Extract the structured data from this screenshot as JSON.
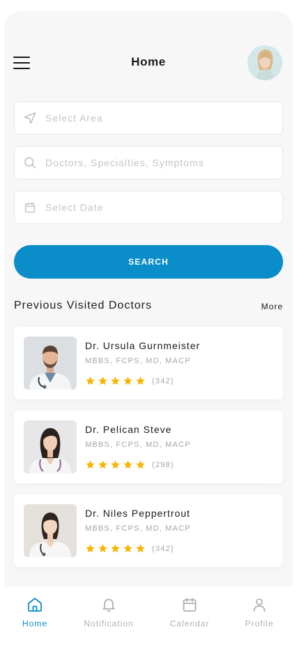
{
  "header": {
    "title": "Home",
    "menu_icon": "hamburger-menu-icon",
    "avatar_icon": "user-avatar"
  },
  "search": {
    "area_placeholder": "Select Area",
    "area_icon": "location-arrow-icon",
    "query_placeholder": "Doctors, Specialties, Symptoms",
    "query_icon": "search-icon",
    "date_placeholder": "Select Date",
    "date_icon": "calendar-icon",
    "button_label": "SEARCH"
  },
  "section": {
    "title": "Previous Visited Doctors",
    "more_label": "More"
  },
  "doctors": [
    {
      "name": "Dr. Ursula Gurnmeister",
      "qualifications": "MBBS, FCPS, MD, MACP",
      "rating": 5,
      "reviews": "(342)"
    },
    {
      "name": "Dr. Pelican Steve",
      "qualifications": "MBBS, FCPS, MD, MACP",
      "rating": 5,
      "reviews": "(298)"
    },
    {
      "name": "Dr. Niles Peppertrout",
      "qualifications": "MBBS, FCPS, MD, MACP",
      "rating": 5,
      "reviews": "(342)"
    }
  ],
  "tabs": [
    {
      "label": "Home",
      "icon": "home-icon",
      "active": true
    },
    {
      "label": "Notification",
      "icon": "bell-icon",
      "active": false
    },
    {
      "label": "Calendar",
      "icon": "calendar-icon",
      "active": false
    },
    {
      "label": "Profile",
      "icon": "user-icon",
      "active": false
    }
  ],
  "colors": {
    "accent": "#0a8dc8",
    "star": "#f7b500",
    "background": "#f7f7f7"
  }
}
